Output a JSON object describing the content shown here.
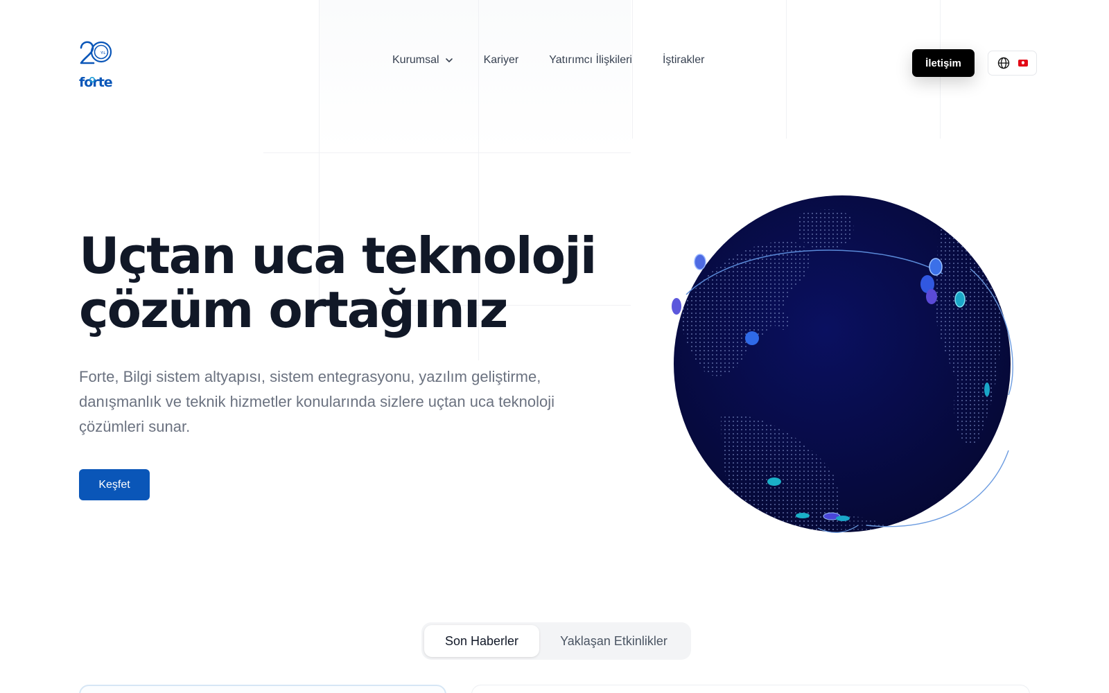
{
  "brand": {
    "logo_name": "Forte 20 yıl logo",
    "color": "#0a56b8"
  },
  "nav": {
    "items": [
      {
        "label": "Kurumsal",
        "has_dropdown": true
      },
      {
        "label": "Kariyer",
        "has_dropdown": false
      },
      {
        "label": "Yatırımcı İlişkileri",
        "has_dropdown": false
      },
      {
        "label": "İştirakler",
        "has_dropdown": false
      }
    ],
    "contact_label": "İletişim",
    "language_icon": "globe-icon",
    "language_flag": "tr"
  },
  "hero": {
    "title_line1": "Uçtan uca teknoloji",
    "title_line2": "çözüm ortağınız",
    "description": "Forte, Bilgi sistem altyapısı, sistem entegrasyonu, yazılım geliştirme, danışmanlık ve teknik hizmetler konularında sizlere uçtan uca teknoloji çözümleri sunar.",
    "cta_label": "Keşfet"
  },
  "globe": {
    "fill_color": "#070b4a",
    "dot_color": "#6f7fb8",
    "arc_color": "#6b9be0"
  },
  "tabs": {
    "items": [
      {
        "label": "Son Haberler",
        "active": true
      },
      {
        "label": "Yaklaşan Etkinlikler",
        "active": false
      }
    ]
  }
}
